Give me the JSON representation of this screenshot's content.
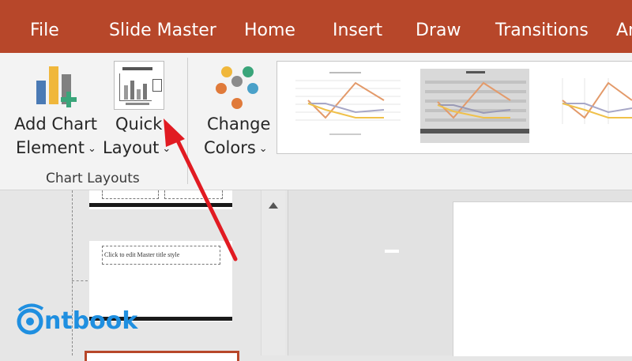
{
  "tabs": [
    "File",
    "Slide Master",
    "Home",
    "Insert",
    "Draw",
    "Transitions",
    "Ar"
  ],
  "ribbon": {
    "add_chart_element": {
      "line1": "Add Chart",
      "line2": "Element"
    },
    "quick_layout": {
      "line1": "Quick",
      "line2": "Layout"
    },
    "change_colors": {
      "line1": "Change",
      "line2": "Colors"
    },
    "group_label": "Chart Layouts"
  },
  "chevron": "⌄",
  "slide_thumb": {
    "title_placeholder": "Click to edit Master title style"
  },
  "watermark": {
    "text": "ntbook"
  },
  "colors": {
    "accent": "#b7472a",
    "ribbon": "#f3f3f3",
    "arrow": "#e11b22"
  }
}
